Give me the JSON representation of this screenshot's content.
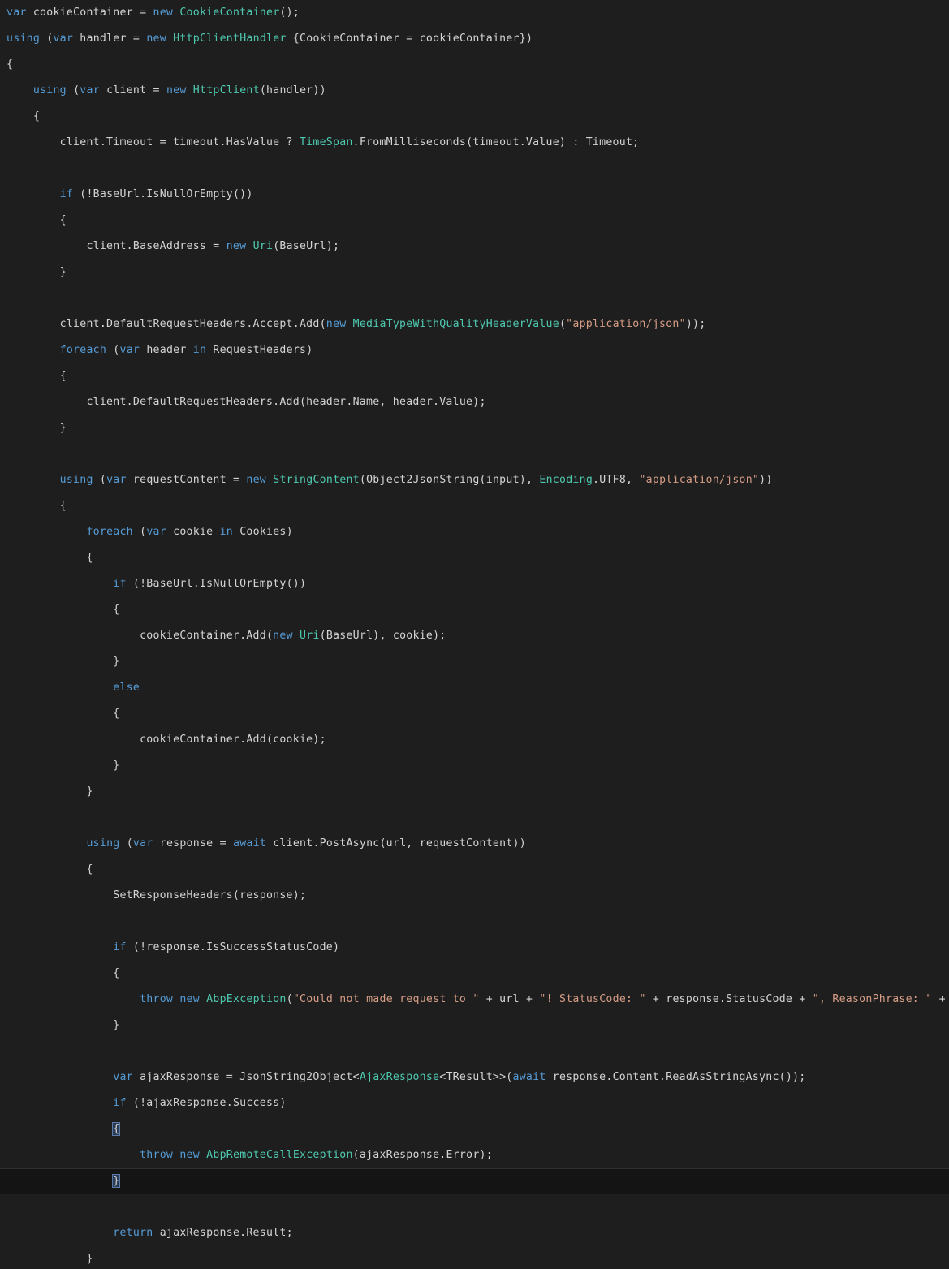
{
  "editor": {
    "name": "code-editor",
    "language": "csharp",
    "theme": "dark",
    "background_color": "#1e1e1e",
    "current_line_background": "#141414",
    "colors": {
      "default_text": "#d4d4d4",
      "keyword": "#569cd6",
      "type": "#4ec9b0",
      "string": "#d69d85",
      "brace_match_background": "#2b3b55"
    },
    "line_height_px": 32,
    "font_size_px": 13.2,
    "current_line_number": 44,
    "caret_line_text": "            }"
  },
  "code": {
    "lines": [
      {
        "n": 1,
        "tokens": [
          {
            "t": "kw",
            "v": "var"
          },
          {
            "t": "plain",
            "v": " cookieContainer = "
          },
          {
            "t": "kw",
            "v": "new"
          },
          {
            "t": "plain",
            "v": " "
          },
          {
            "t": "type",
            "v": "CookieContainer"
          },
          {
            "t": "plain",
            "v": "();"
          }
        ]
      },
      {
        "n": 2,
        "tokens": [
          {
            "t": "kw",
            "v": "using"
          },
          {
            "t": "plain",
            "v": " ("
          },
          {
            "t": "kw",
            "v": "var"
          },
          {
            "t": "plain",
            "v": " handler = "
          },
          {
            "t": "kw",
            "v": "new"
          },
          {
            "t": "plain",
            "v": " "
          },
          {
            "t": "type",
            "v": "HttpClientHandler"
          },
          {
            "t": "plain",
            "v": " {CookieContainer = cookieContainer})"
          }
        ]
      },
      {
        "n": 3,
        "tokens": [
          {
            "t": "plain",
            "v": "{"
          }
        ]
      },
      {
        "n": 4,
        "tokens": [
          {
            "t": "plain",
            "v": "    "
          },
          {
            "t": "kw",
            "v": "using"
          },
          {
            "t": "plain",
            "v": " ("
          },
          {
            "t": "kw",
            "v": "var"
          },
          {
            "t": "plain",
            "v": " client = "
          },
          {
            "t": "kw",
            "v": "new"
          },
          {
            "t": "plain",
            "v": " "
          },
          {
            "t": "type",
            "v": "HttpClient"
          },
          {
            "t": "plain",
            "v": "(handler))"
          }
        ]
      },
      {
        "n": 5,
        "tokens": [
          {
            "t": "plain",
            "v": "    {"
          }
        ]
      },
      {
        "n": 6,
        "tokens": [
          {
            "t": "plain",
            "v": "        client.Timeout = timeout.HasValue ? "
          },
          {
            "t": "type",
            "v": "TimeSpan"
          },
          {
            "t": "plain",
            "v": ".FromMilliseconds(timeout.Value) : Timeout;"
          }
        ]
      },
      {
        "n": 7,
        "tokens": [
          {
            "t": "plain",
            "v": ""
          }
        ]
      },
      {
        "n": 8,
        "tokens": [
          {
            "t": "plain",
            "v": "        "
          },
          {
            "t": "kw",
            "v": "if"
          },
          {
            "t": "plain",
            "v": " (!BaseUrl.IsNullOrEmpty())"
          }
        ]
      },
      {
        "n": 9,
        "tokens": [
          {
            "t": "plain",
            "v": "        {"
          }
        ]
      },
      {
        "n": 10,
        "tokens": [
          {
            "t": "plain",
            "v": "            client.BaseAddress = "
          },
          {
            "t": "kw",
            "v": "new"
          },
          {
            "t": "plain",
            "v": " "
          },
          {
            "t": "type",
            "v": "Uri"
          },
          {
            "t": "plain",
            "v": "(BaseUrl);"
          }
        ]
      },
      {
        "n": 11,
        "tokens": [
          {
            "t": "plain",
            "v": "        }"
          }
        ]
      },
      {
        "n": 12,
        "tokens": [
          {
            "t": "plain",
            "v": ""
          }
        ]
      },
      {
        "n": 13,
        "tokens": [
          {
            "t": "plain",
            "v": "        client.DefaultRequestHeaders.Accept.Add("
          },
          {
            "t": "kw",
            "v": "new"
          },
          {
            "t": "plain",
            "v": " "
          },
          {
            "t": "type",
            "v": "MediaTypeWithQualityHeaderValue"
          },
          {
            "t": "plain",
            "v": "("
          },
          {
            "t": "str",
            "v": "\"application/json\""
          },
          {
            "t": "plain",
            "v": "));"
          }
        ]
      },
      {
        "n": 14,
        "tokens": [
          {
            "t": "plain",
            "v": "        "
          },
          {
            "t": "kw",
            "v": "foreach"
          },
          {
            "t": "plain",
            "v": " ("
          },
          {
            "t": "kw",
            "v": "var"
          },
          {
            "t": "plain",
            "v": " header "
          },
          {
            "t": "kw",
            "v": "in"
          },
          {
            "t": "plain",
            "v": " RequestHeaders)"
          }
        ]
      },
      {
        "n": 15,
        "tokens": [
          {
            "t": "plain",
            "v": "        {"
          }
        ]
      },
      {
        "n": 16,
        "tokens": [
          {
            "t": "plain",
            "v": "            client.DefaultRequestHeaders.Add(header.Name, header.Value);"
          }
        ]
      },
      {
        "n": 17,
        "tokens": [
          {
            "t": "plain",
            "v": "        }"
          }
        ]
      },
      {
        "n": 18,
        "tokens": [
          {
            "t": "plain",
            "v": ""
          }
        ]
      },
      {
        "n": 19,
        "tokens": [
          {
            "t": "plain",
            "v": "        "
          },
          {
            "t": "kw",
            "v": "using"
          },
          {
            "t": "plain",
            "v": " ("
          },
          {
            "t": "kw",
            "v": "var"
          },
          {
            "t": "plain",
            "v": " requestContent = "
          },
          {
            "t": "kw",
            "v": "new"
          },
          {
            "t": "plain",
            "v": " "
          },
          {
            "t": "type",
            "v": "StringContent"
          },
          {
            "t": "plain",
            "v": "(Object2JsonString(input), "
          },
          {
            "t": "type",
            "v": "Encoding"
          },
          {
            "t": "plain",
            "v": ".UTF8, "
          },
          {
            "t": "str",
            "v": "\"application/json\""
          },
          {
            "t": "plain",
            "v": "))"
          }
        ]
      },
      {
        "n": 20,
        "tokens": [
          {
            "t": "plain",
            "v": "        {"
          }
        ]
      },
      {
        "n": 21,
        "tokens": [
          {
            "t": "plain",
            "v": "            "
          },
          {
            "t": "kw",
            "v": "foreach"
          },
          {
            "t": "plain",
            "v": " ("
          },
          {
            "t": "kw",
            "v": "var"
          },
          {
            "t": "plain",
            "v": " cookie "
          },
          {
            "t": "kw",
            "v": "in"
          },
          {
            "t": "plain",
            "v": " Cookies)"
          }
        ]
      },
      {
        "n": 22,
        "tokens": [
          {
            "t": "plain",
            "v": "            {"
          }
        ]
      },
      {
        "n": 23,
        "tokens": [
          {
            "t": "plain",
            "v": "                "
          },
          {
            "t": "kw",
            "v": "if"
          },
          {
            "t": "plain",
            "v": " (!BaseUrl.IsNullOrEmpty())"
          }
        ]
      },
      {
        "n": 24,
        "tokens": [
          {
            "t": "plain",
            "v": "                {"
          }
        ]
      },
      {
        "n": 25,
        "tokens": [
          {
            "t": "plain",
            "v": "                    cookieContainer.Add("
          },
          {
            "t": "kw",
            "v": "new"
          },
          {
            "t": "plain",
            "v": " "
          },
          {
            "t": "type",
            "v": "Uri"
          },
          {
            "t": "plain",
            "v": "(BaseUrl), cookie);"
          }
        ]
      },
      {
        "n": 26,
        "tokens": [
          {
            "t": "plain",
            "v": "                }"
          }
        ]
      },
      {
        "n": 27,
        "tokens": [
          {
            "t": "plain",
            "v": "                "
          },
          {
            "t": "kw",
            "v": "else"
          }
        ]
      },
      {
        "n": 28,
        "tokens": [
          {
            "t": "plain",
            "v": "                {"
          }
        ]
      },
      {
        "n": 29,
        "tokens": [
          {
            "t": "plain",
            "v": "                    cookieContainer.Add(cookie);"
          }
        ]
      },
      {
        "n": 30,
        "tokens": [
          {
            "t": "plain",
            "v": "                }"
          }
        ]
      },
      {
        "n": 31,
        "tokens": [
          {
            "t": "plain",
            "v": "            }"
          }
        ]
      },
      {
        "n": 32,
        "tokens": [
          {
            "t": "plain",
            "v": ""
          }
        ]
      },
      {
        "n": 33,
        "tokens": [
          {
            "t": "plain",
            "v": "            "
          },
          {
            "t": "kw",
            "v": "using"
          },
          {
            "t": "plain",
            "v": " ("
          },
          {
            "t": "kw",
            "v": "var"
          },
          {
            "t": "plain",
            "v": " response = "
          },
          {
            "t": "kw",
            "v": "await"
          },
          {
            "t": "plain",
            "v": " client.PostAsync(url, requestContent))"
          }
        ]
      },
      {
        "n": 34,
        "tokens": [
          {
            "t": "plain",
            "v": "            {"
          }
        ]
      },
      {
        "n": 35,
        "tokens": [
          {
            "t": "plain",
            "v": "                SetResponseHeaders(response);"
          }
        ]
      },
      {
        "n": 36,
        "tokens": [
          {
            "t": "plain",
            "v": ""
          }
        ]
      },
      {
        "n": 37,
        "tokens": [
          {
            "t": "plain",
            "v": "                "
          },
          {
            "t": "kw",
            "v": "if"
          },
          {
            "t": "plain",
            "v": " (!response.IsSuccessStatusCode)"
          }
        ]
      },
      {
        "n": 38,
        "tokens": [
          {
            "t": "plain",
            "v": "                {"
          }
        ]
      },
      {
        "n": 39,
        "tokens": [
          {
            "t": "plain",
            "v": "                    "
          },
          {
            "t": "kw",
            "v": "throw"
          },
          {
            "t": "plain",
            "v": " "
          },
          {
            "t": "kw",
            "v": "new"
          },
          {
            "t": "plain",
            "v": " "
          },
          {
            "t": "type",
            "v": "AbpException"
          },
          {
            "t": "plain",
            "v": "("
          },
          {
            "t": "str",
            "v": "\"Could not made request to \""
          },
          {
            "t": "plain",
            "v": " + url + "
          },
          {
            "t": "str",
            "v": "\"! StatusCode: \""
          },
          {
            "t": "plain",
            "v": " + response.StatusCode + "
          },
          {
            "t": "str",
            "v": "\", ReasonPhrase: \""
          },
          {
            "t": "plain",
            "v": " + response.ReasonPhrase);"
          }
        ]
      },
      {
        "n": 40,
        "tokens": [
          {
            "t": "plain",
            "v": "                }"
          }
        ]
      },
      {
        "n": 41,
        "tokens": [
          {
            "t": "plain",
            "v": ""
          }
        ]
      },
      {
        "n": 42,
        "tokens": [
          {
            "t": "plain",
            "v": "                "
          },
          {
            "t": "kw",
            "v": "var"
          },
          {
            "t": "plain",
            "v": " ajaxResponse = JsonString2Object<"
          },
          {
            "t": "type",
            "v": "AjaxResponse"
          },
          {
            "t": "plain",
            "v": "<TResult>>("
          },
          {
            "t": "kw",
            "v": "await"
          },
          {
            "t": "plain",
            "v": " response.Content.ReadAsStringAsync());"
          }
        ]
      },
      {
        "n": 43,
        "tokens": [
          {
            "t": "plain",
            "v": "                "
          },
          {
            "t": "kw",
            "v": "if"
          },
          {
            "t": "plain",
            "v": " (!ajaxResponse.Success)"
          }
        ]
      },
      {
        "n": 44,
        "tokens": [
          {
            "t": "plain",
            "v": "                "
          },
          {
            "t": "brace",
            "v": "{"
          }
        ]
      },
      {
        "n": 45,
        "tokens": [
          {
            "t": "plain",
            "v": "                    "
          },
          {
            "t": "kw",
            "v": "throw"
          },
          {
            "t": "plain",
            "v": " "
          },
          {
            "t": "kw",
            "v": "new"
          },
          {
            "t": "plain",
            "v": " "
          },
          {
            "t": "type",
            "v": "AbpRemoteCallException"
          },
          {
            "t": "plain",
            "v": "(ajaxResponse.Error);"
          }
        ]
      },
      {
        "n": 46,
        "current": true,
        "tokens": [
          {
            "t": "plain",
            "v": "                "
          },
          {
            "t": "brace",
            "v": "}"
          },
          {
            "t": "caret",
            "v": ""
          }
        ]
      },
      {
        "n": 47,
        "tokens": [
          {
            "t": "plain",
            "v": ""
          }
        ]
      },
      {
        "n": 48,
        "tokens": [
          {
            "t": "plain",
            "v": "                "
          },
          {
            "t": "kw",
            "v": "return"
          },
          {
            "t": "plain",
            "v": " ajaxResponse.Result;"
          }
        ]
      },
      {
        "n": 49,
        "tokens": [
          {
            "t": "plain",
            "v": "            }"
          }
        ]
      }
    ]
  }
}
